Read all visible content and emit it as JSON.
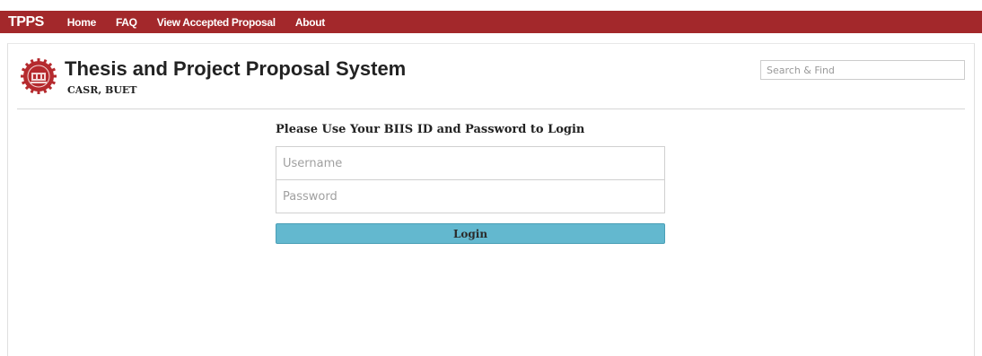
{
  "navbar": {
    "brand": "TPPS",
    "links": [
      "Home",
      "FAQ",
      "View Accepted Proposal",
      "About"
    ]
  },
  "header": {
    "title": "Thesis and Project Proposal System",
    "subtitle": "CASR, BUET",
    "search_placeholder": "Search & Find"
  },
  "login": {
    "heading": "Please Use Your BIIS ID and Password to Login",
    "username_placeholder": "Username",
    "password_placeholder": "Password",
    "button_label": "Login"
  },
  "colors": {
    "navbar_bg": "#a3282b",
    "button_bg": "#63b8cf",
    "logo_red": "#b52a2e"
  },
  "icons": {
    "logo": "university-seal-icon"
  }
}
